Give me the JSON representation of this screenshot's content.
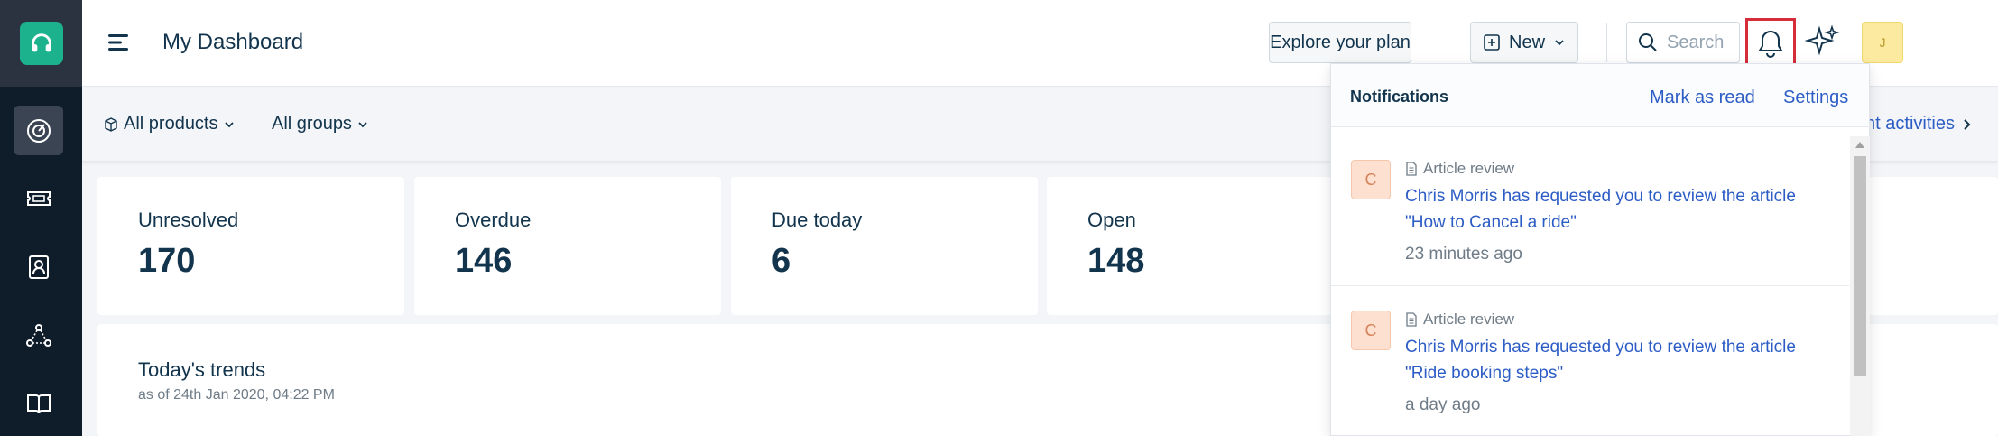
{
  "app": {
    "title": "My Dashboard"
  },
  "sidebar": {
    "items": [
      {
        "name": "dashboard",
        "icon": "gauge-icon",
        "active": true
      },
      {
        "name": "tickets",
        "icon": "ticket-icon",
        "active": false
      },
      {
        "name": "contacts",
        "icon": "contact-icon",
        "active": false
      },
      {
        "name": "social",
        "icon": "network-icon",
        "active": false
      },
      {
        "name": "solutions",
        "icon": "book-icon",
        "active": false
      }
    ]
  },
  "header": {
    "explore_label": "Explore your plan",
    "new_label": "New",
    "search_placeholder": "Search",
    "avatar_initial": "J"
  },
  "filters": {
    "products_label": "All products",
    "groups_label": "All groups",
    "recent_link": "ent activities"
  },
  "cards": [
    {
      "label": "Unresolved",
      "value": "170"
    },
    {
      "label": "Overdue",
      "value": "146"
    },
    {
      "label": "Due today",
      "value": "6"
    },
    {
      "label": "Open",
      "value": "148"
    }
  ],
  "trends": {
    "title": "Today's trends",
    "subtitle": "as of 24th Jan 2020, 04:22 PM"
  },
  "notifications": {
    "title": "Notifications",
    "mark_read_label": "Mark as read",
    "settings_label": "Settings",
    "items": [
      {
        "avatar": "C",
        "type": "Article review",
        "message": "Chris Morris has requested you to review the article \"How to Cancel a ride\"",
        "time": "23 minutes ago"
      },
      {
        "avatar": "C",
        "type": "Article review",
        "message": "Chris Morris has requested you to review the article \"Ride booking steps\"",
        "time": "a day ago"
      }
    ]
  },
  "colors": {
    "sidebar_bg": "#0f1c2a",
    "brand_green": "#1cb28d",
    "link_blue": "#2c5cc5",
    "highlight_red": "#d62d3a"
  }
}
